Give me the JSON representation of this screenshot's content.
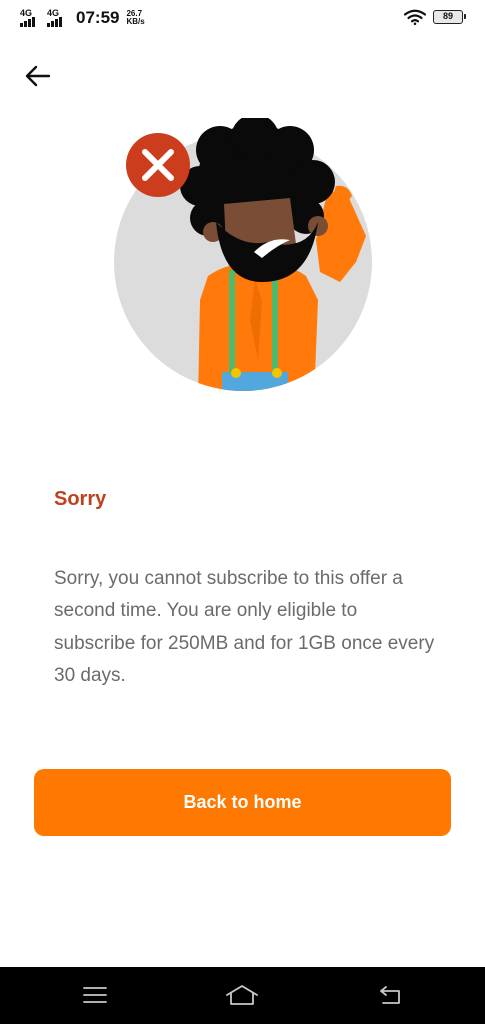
{
  "status_bar": {
    "network_1": "4G",
    "network_2": "4G",
    "time": "07:59",
    "speed_value": "26.7",
    "speed_unit": "KB/s",
    "wifi_icon": "wifi-icon",
    "battery_level": "89"
  },
  "header": {
    "back_icon": "arrow-left-icon"
  },
  "illustration": {
    "error_icon": "close-icon",
    "error_color": "#cc3d1e",
    "figure": "confused-man-illustration"
  },
  "content": {
    "title": "Sorry",
    "message": "Sorry, you cannot subscribe to this offer a second time. You are only eligible to subscribe for 250MB and for 1GB once every 30 days."
  },
  "actions": {
    "primary_label": "Back to home",
    "primary_color": "#ff7900"
  },
  "nav_bar": {
    "menu_icon": "menu-icon",
    "home_icon": "home-icon",
    "back_icon": "back-icon"
  },
  "colors": {
    "title": "#c0401f",
    "text": "#6b6b6b",
    "accent": "#ff7900"
  }
}
